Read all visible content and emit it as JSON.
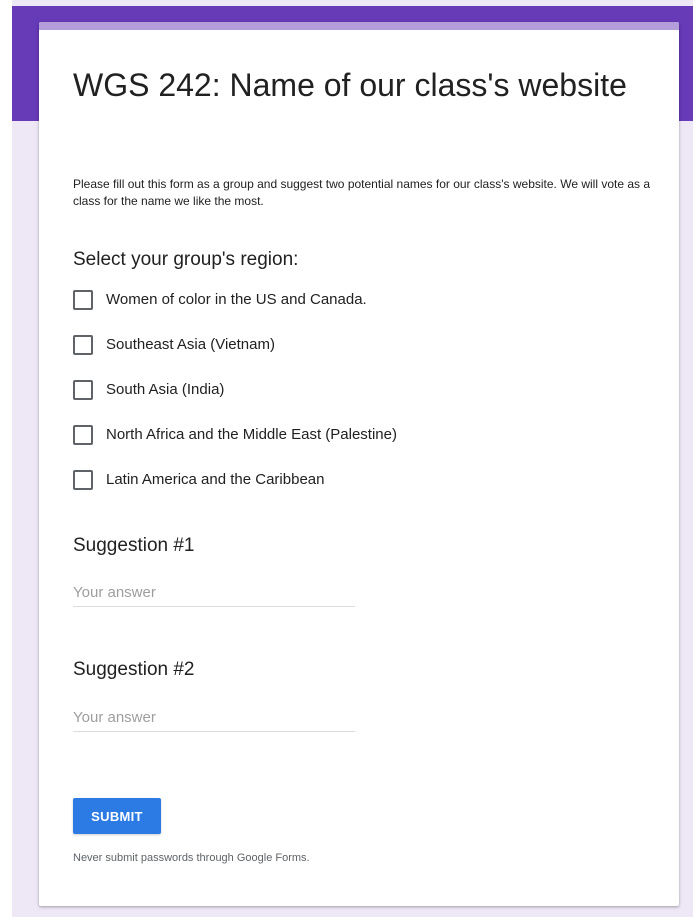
{
  "form": {
    "title": "WGS 242: Name of our class's website",
    "description": "Please fill out this form as a group and suggest two potential names for our class's website. We will vote as a class for the name we like the most."
  },
  "region_question": {
    "title": "Select your group's region:",
    "options": [
      {
        "label": "Women of color in the US and Canada.",
        "checked": false
      },
      {
        "label": "Southeast Asia (Vietnam)",
        "checked": false
      },
      {
        "label": "South Asia (India)",
        "checked": false
      },
      {
        "label": "North Africa and the Middle East (Palestine)",
        "checked": false
      },
      {
        "label": "Latin America and the Caribbean",
        "checked": false
      }
    ]
  },
  "suggestion_1": {
    "title": "Suggestion #1",
    "placeholder": "Your answer",
    "value": ""
  },
  "suggestion_2": {
    "title": "Suggestion #2",
    "placeholder": "Your answer",
    "value": ""
  },
  "submit": {
    "label": "SUBMIT"
  },
  "footer": {
    "note": "Never submit passwords through Google Forms."
  },
  "colors": {
    "header_band": "#673ab7",
    "page_background": "#ede7f6",
    "card_accent": "#b39ddb",
    "submit_button": "#2c7be5"
  }
}
